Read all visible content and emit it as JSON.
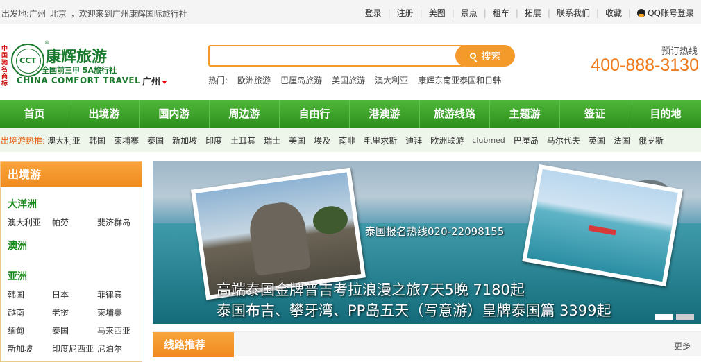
{
  "topbar": {
    "departure_label": "出发地:广州",
    "departure_alt": "北京",
    "welcome": "，欢迎来到广州康辉国际旅行社",
    "links": [
      "登录",
      "注册",
      "美图",
      "景点",
      "租车",
      "拓展",
      "联系我们",
      "收藏"
    ],
    "qq_login": "QQ账号登录"
  },
  "logo": {
    "badge": "中国驰名商标",
    "circle_text": "CCT",
    "registered": "®",
    "name": "康辉旅游",
    "subtitle": "全国前三甲 5A旅行社",
    "english": "CHINA COMFORT TRAVEL"
  },
  "city_selector": {
    "value": "广州"
  },
  "search": {
    "placeholder": "",
    "button_label": "搜索"
  },
  "hot_search": {
    "label": "热门:",
    "items": [
      "欧洲旅游",
      "巴厘岛旅游",
      "美国旅游",
      "澳大利亚",
      "康辉东南亚泰国和日韩"
    ]
  },
  "hotline": {
    "label": "预订热线",
    "number": "400-888-3130"
  },
  "nav": {
    "items": [
      "首页",
      "出境游",
      "国内游",
      "周边游",
      "自由行",
      "港澳游",
      "旅游线路",
      "主题游",
      "签证",
      "目的地"
    ]
  },
  "subnav": {
    "label": "出境游热推:",
    "items": [
      "澳大利亚",
      "韩国",
      "柬埔寨",
      "泰国",
      "新加坡",
      "印度",
      "土耳其",
      "瑞士",
      "美国",
      "埃及",
      "南非",
      "毛里求斯",
      "迪拜",
      "欧洲联游",
      "clubmed",
      "巴厘岛",
      "马尔代夫",
      "英国",
      "法国",
      "俄罗斯"
    ]
  },
  "sidebar": {
    "title": "出境游",
    "regions": [
      {
        "name": "大洋洲",
        "countries": [
          "澳大利亚",
          "帕劳",
          "斐济群岛"
        ]
      },
      {
        "name": "澳洲",
        "countries": []
      },
      {
        "name": "亚洲",
        "countries": [
          "韩国",
          "日本",
          "菲律宾",
          "越南",
          "老挝",
          "柬埔寨",
          "缅甸",
          "泰国",
          "马来西亚",
          "新加坡",
          "印度尼西亚",
          "尼泊尔"
        ]
      }
    ]
  },
  "banner": {
    "phone": "泰国报名热线020-22098155",
    "line1": "高端泰国金牌普吉考拉浪漫之旅7天5晚  7180起",
    "line2": "泰国布吉、攀牙湾、PP岛五天（写意游）皇牌泰国篇  3399起"
  },
  "recommend": {
    "title": "线路推荐",
    "more": "更多"
  }
}
